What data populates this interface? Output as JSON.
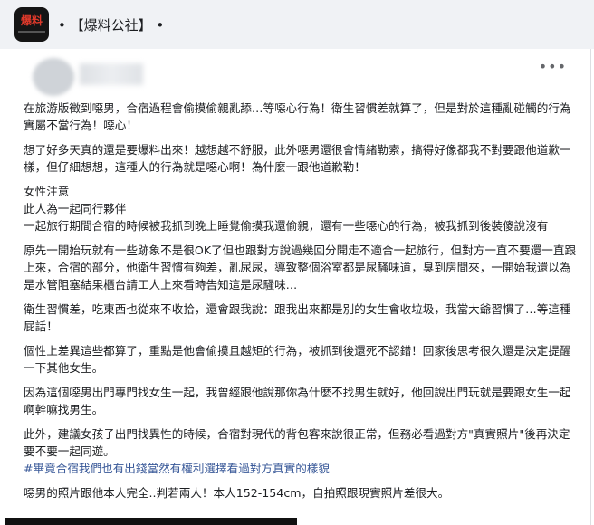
{
  "header": {
    "logo_text": "爆料",
    "source_label": "• 【爆料公社】 •"
  },
  "post": {
    "more_icon": "•••",
    "paragraphs": [
      "在旅游版徵到噁男，合宿過程會偷摸偷親亂舔…等噁心行為！衛生習慣差就算了，但是對於這種亂碰觸的行為實屬不當行為！噁心！",
      "想了好多天真的還是要爆料出來！越想越不舒服，此外噁男還很會情緒勒索，搞得好像都我不對要跟他道歉一樣，但仔細想想，這種人的行為就是噁心啊！為什麼一跟他道歉勒！",
      "女性注意\n此人為一起同行夥伴\n一起旅行期間合宿的時候被我抓到晚上睡覺偷摸我還偷親，還有一些噁心的行為，被我抓到後裝傻說沒有",
      "原先一開始玩就有一些跡象不是很OK了但也跟對方說過幾回分開走不適合一起旅行，但對方一直不要還一直跟上來，合宿的部分，他衛生習慣有夠差，亂尿尿，導致整個浴室都是尿騷味道，臭到房間來，一開始我還以為是水管阻塞結果櫃台請工人上來看時告知這是尿騷味…",
      "衛生習慣差，吃東西也從來不收拾，還會跟我說：跟我出來都是別的女生會收垃圾，我當大爺習慣了…等這種屁話！",
      "個性上差異這些都算了，重點是他會偷摸且越矩的行為，被抓到後還死不認錯！回家後思考很久還是決定提醒一下其他女生。",
      "因為這個噁男出門專門找女生一起，我曾經跟他說那你為什麼不找男生就好，他回說出門玩就是要跟女生一起啊幹嘛找男生。",
      "此外，建議女孩子出門找異性的時候，合宿對現代的背包客來說很正常，但務必看過對方\"真實照片\"後再決定要不要一起同遊。"
    ],
    "hashtag": "#畢竟合宿我們也有出錢當然有權利選擇看過對方真實的樣貌",
    "last_paragraph": "噁男的照片跟他本人完全..判若兩人！本人152-154cm，自拍照跟現實照片差很大。"
  }
}
